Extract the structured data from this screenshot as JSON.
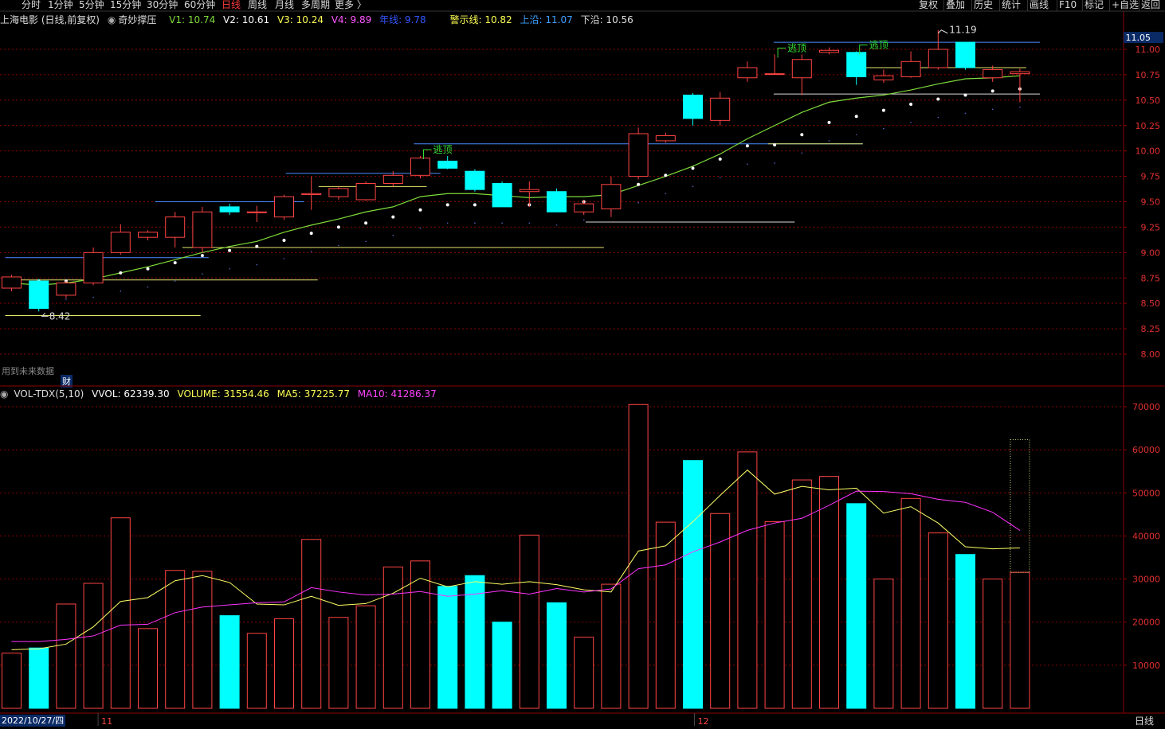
{
  "topbar": {
    "periods": [
      "分时",
      "1分钟",
      "5分钟",
      "15分钟",
      "30分钟",
      "60分钟",
      "日线",
      "周线",
      "月线",
      "多周期",
      "更多 〉"
    ],
    "active_index": 6,
    "right_buttons": [
      "复权",
      "叠加",
      "历史",
      "统计",
      "画线",
      "F10",
      "标记",
      "+自选",
      "返回"
    ]
  },
  "header": {
    "title": "上海电影 (日线,前复权)",
    "indicator": "奇妙撑压",
    "v1": "V1: 10.74",
    "v2": "V2: 10.61",
    "v3": "V3: 10.24",
    "v4": "V4: 9.89",
    "v5": "年线: 9.78",
    "warn": "警示线: 10.82",
    "upper": "上沿: 11.07",
    "lower": "下沿: 10.56"
  },
  "vol_header": {
    "name": "VOL-TDX(5,10)",
    "vvol": "VVOL: 62339.30",
    "volume": "VOLUME: 31554.46",
    "ma5": "MA5: 37225.77",
    "ma10": "MA10: 41286.37"
  },
  "notes": {
    "future_data": "用到未来数据",
    "cai": "财",
    "date": "2022/10/27/四",
    "month_11": "11",
    "month_12": "12",
    "period_label": "日线",
    "current_price": "11.05",
    "high_label": "11.19",
    "low_label": "8.42",
    "escape": "逃顶"
  },
  "colors": {
    "up": "#ff4444",
    "down": "#00ffff",
    "ma_line": "#7fdc3a",
    "vol_ma5": "#ffff66",
    "vol_ma10": "#ff33ff",
    "grid": "#8b0000",
    "support_blue": "#4a8cff",
    "support_yellow": "#e6e66a"
  },
  "chart_data": [
    {
      "type": "candlestick",
      "ylim": [
        7.9,
        11.2
      ],
      "yticks": [
        "11.00",
        "10.75",
        "10.50",
        "10.25",
        "10.00",
        "9.75",
        "9.50",
        "9.25",
        "9.00",
        "8.75",
        "8.50",
        "8.25",
        "8.00"
      ],
      "candles": [
        [
          8.65,
          8.78,
          8.62,
          8.76
        ],
        [
          8.72,
          8.74,
          8.42,
          8.45
        ],
        [
          8.58,
          8.72,
          8.55,
          8.7
        ],
        [
          8.7,
          9.05,
          8.68,
          9.0
        ],
        [
          9.0,
          9.28,
          8.98,
          9.2
        ],
        [
          9.15,
          9.22,
          9.12,
          9.2
        ],
        [
          9.15,
          9.4,
          9.05,
          9.35
        ],
        [
          9.05,
          9.45,
          9.0,
          9.4
        ],
        [
          9.45,
          9.48,
          9.37,
          9.4
        ],
        [
          9.4,
          9.46,
          9.3,
          9.4
        ],
        [
          9.35,
          9.57,
          9.32,
          9.55
        ],
        [
          9.57,
          9.75,
          9.42,
          9.58
        ],
        [
          9.55,
          9.65,
          9.52,
          9.63
        ],
        [
          9.52,
          9.7,
          9.51,
          9.68
        ],
        [
          9.68,
          9.8,
          9.65,
          9.76
        ],
        [
          9.76,
          9.95,
          9.73,
          9.93
        ],
        [
          9.9,
          9.95,
          9.82,
          9.83
        ],
        [
          9.8,
          9.82,
          9.6,
          9.62
        ],
        [
          9.68,
          9.7,
          9.45,
          9.45
        ],
        [
          9.6,
          9.7,
          9.45,
          9.62
        ],
        [
          9.6,
          9.63,
          9.4,
          9.4
        ],
        [
          9.4,
          9.52,
          9.37,
          9.48
        ],
        [
          9.43,
          9.75,
          9.35,
          9.67
        ],
        [
          9.75,
          10.23,
          9.72,
          10.17
        ],
        [
          10.1,
          10.18,
          10.08,
          10.15
        ],
        [
          10.55,
          10.57,
          10.25,
          10.32
        ],
        [
          10.3,
          10.58,
          10.25,
          10.52
        ],
        [
          10.72,
          10.88,
          10.68,
          10.82
        ],
        [
          10.76,
          10.95,
          10.75,
          10.76
        ],
        [
          10.72,
          10.95,
          10.55,
          10.9
        ],
        [
          10.97,
          11.02,
          10.95,
          10.99
        ],
        [
          10.97,
          10.98,
          10.65,
          10.73
        ],
        [
          10.7,
          10.8,
          10.67,
          10.74
        ],
        [
          10.73,
          10.98,
          10.72,
          10.88
        ],
        [
          10.82,
          11.19,
          10.8,
          11.0
        ],
        [
          11.07,
          11.07,
          10.8,
          10.82
        ],
        [
          10.72,
          10.84,
          10.68,
          10.8
        ],
        [
          10.76,
          10.81,
          10.48,
          10.78
        ]
      ],
      "ma": [
        8.7,
        8.68,
        8.7,
        8.74,
        8.8,
        8.86,
        8.93,
        9.0,
        9.06,
        9.11,
        9.2,
        9.27,
        9.33,
        9.4,
        9.45,
        9.55,
        9.58,
        9.58,
        9.56,
        9.54,
        9.55,
        9.55,
        9.57,
        9.66,
        9.75,
        9.85,
        9.97,
        10.12,
        10.25,
        10.38,
        10.48,
        10.52,
        10.55,
        10.6,
        10.66,
        10.71,
        10.72,
        10.74
      ],
      "dots": [
        null,
        8.72,
        8.72,
        8.74,
        8.8,
        8.84,
        8.9,
        8.97,
        9.02,
        9.06,
        9.12,
        9.19,
        9.25,
        9.29,
        9.35,
        9.42,
        9.47,
        9.47,
        9.47,
        9.47,
        9.45,
        9.5,
        9.59,
        9.67,
        9.76,
        9.83,
        9.92,
        10.05,
        10.06,
        10.16,
        10.28,
        10.34,
        10.4,
        10.46,
        10.51,
        10.55,
        10.59,
        10.61
      ],
      "supports": [
        {
          "y": 8.95,
          "from": 0,
          "to": 7,
          "color": "blue"
        },
        {
          "y": 8.73,
          "from": 0,
          "to": 11,
          "color": "yellow"
        },
        {
          "y": 8.38,
          "from": 0,
          "to": 6.7,
          "color": "yellow"
        },
        {
          "y": 9.5,
          "from": 5.5,
          "to": 10.5,
          "color": "blue"
        },
        {
          "y": 9.05,
          "from": 6.5,
          "to": 21.5,
          "color": "yellow"
        },
        {
          "y": 9.78,
          "from": 10.3,
          "to": 15.5,
          "color": "blue"
        },
        {
          "y": 9.65,
          "from": 11.5,
          "to": 15,
          "color": "yellow"
        },
        {
          "y": 10.07,
          "from": 15,
          "to": 31,
          "color": "blue"
        },
        {
          "y": 10.07,
          "from": 28,
          "to": 31,
          "color": "yellow"
        },
        {
          "y": 9.3,
          "from": 21.3,
          "to": 28.5,
          "color": "white"
        },
        {
          "y": 11.07,
          "from": 28.2,
          "to": 37.5,
          "color": "blue"
        },
        {
          "y": 10.82,
          "from": 31,
          "to": 37,
          "color": "yellow"
        },
        {
          "y": 10.56,
          "from": 28.2,
          "to": 37.5,
          "color": "white"
        }
      ],
      "escapes": [
        15,
        28,
        31
      ]
    },
    {
      "type": "bar",
      "ylim": [
        0,
        72000
      ],
      "yticks": [
        "70000",
        "60000",
        "50000",
        "40000",
        "30000",
        "20000",
        "10000"
      ],
      "volumes": [
        12800,
        14000,
        24200,
        29000,
        44200,
        18500,
        32000,
        31800,
        21500,
        17400,
        20800,
        39200,
        21100,
        23800,
        32800,
        34200,
        28300,
        30800,
        20000,
        40200,
        24500,
        16500,
        28800,
        70500,
        43200,
        57500,
        45200,
        59500,
        43300,
        53000,
        53800,
        47500,
        30000,
        48700,
        40700,
        35700,
        30000,
        31554
      ],
      "ma5": [
        13600,
        13800,
        14900,
        18900,
        24800,
        25700,
        29600,
        30800,
        29200,
        24200,
        24000,
        26000,
        23900,
        24300,
        26700,
        30200,
        28200,
        29400,
        28800,
        29400,
        28700,
        27500,
        27000,
        36500,
        37700,
        43300,
        49400,
        55300,
        49700,
        51500,
        50700,
        51100,
        45300,
        46800,
        43000,
        37500,
        37000,
        37226
      ],
      "ma10": [
        15500,
        15500,
        16000,
        16800,
        19300,
        19500,
        22200,
        23500,
        24000,
        24500,
        24700,
        28000,
        27000,
        26300,
        26500,
        27100,
        26000,
        26500,
        27300,
        26500,
        27800,
        27000,
        27700,
        32400,
        33300,
        36300,
        38600,
        41300,
        43000,
        44100,
        47100,
        50400,
        50300,
        49800,
        48500,
        47800,
        45500,
        41286
      ],
      "vvol": 62339
    }
  ]
}
